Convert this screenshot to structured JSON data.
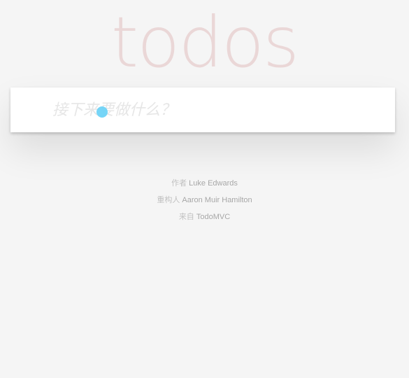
{
  "header": {
    "title": "todos"
  },
  "new_todo": {
    "placeholder": "接下来要做什么？",
    "value": ""
  },
  "footer_info": {
    "author_prefix": "作者",
    "author_name": "Luke Edwards",
    "refactor_prefix": "重构人",
    "refactor_name": "Aaron Muir Hamilton",
    "source_prefix": "来自",
    "source_name": "TodoMVC"
  },
  "colors": {
    "title": "#ead7d7",
    "cursor_indicator": "#6fd3f7",
    "background": "#f5f5f5"
  }
}
